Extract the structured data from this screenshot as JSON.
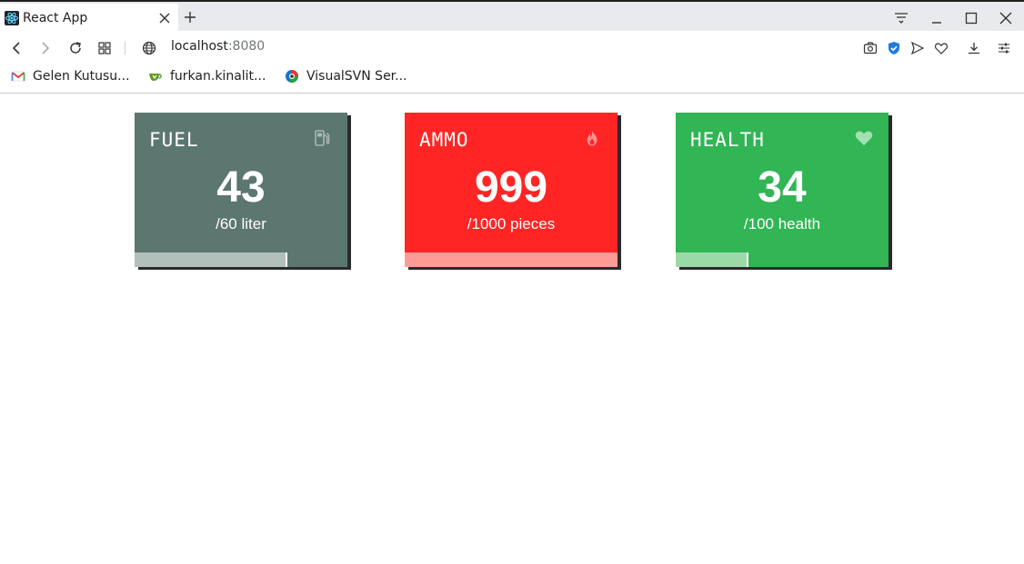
{
  "browser": {
    "tab_title": "React App",
    "url_host": "localhost",
    "url_port": ":8080",
    "bookmarks": [
      {
        "label": "Gelen Kutusu...",
        "icon": "gmail-icon"
      },
      {
        "label": "furkan.kinalit...",
        "icon": "gitea-icon"
      },
      {
        "label": "VisualSVN Ser...",
        "icon": "visualsvn-icon"
      }
    ]
  },
  "cards": [
    {
      "title": "FUEL",
      "value": "43",
      "unit": "/60 liter",
      "icon": "fuel-pump-icon",
      "fill": 0.7167,
      "color": "#5c7670"
    },
    {
      "title": "AMMO",
      "value": "999",
      "unit": "/1000 pieces",
      "icon": "fire-icon",
      "fill": 0.999,
      "color": "#ff2525"
    },
    {
      "title": "HEALTH",
      "value": "34",
      "unit": "/100 health",
      "icon": "heart-icon",
      "fill": 0.34,
      "color": "#31b555"
    }
  ]
}
